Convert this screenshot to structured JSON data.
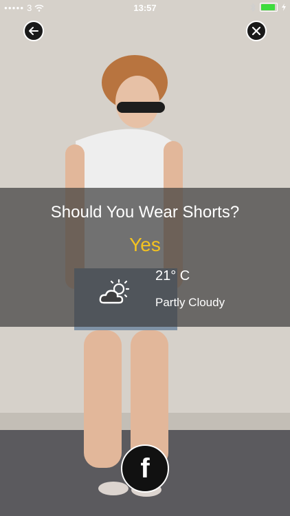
{
  "status": {
    "carrier": "3",
    "time": "13:57",
    "battery_color": "#3ddc3d"
  },
  "nav": {
    "back_icon": "arrow-left-icon",
    "close_icon": "close-icon"
  },
  "card": {
    "question": "Should You Wear Shorts?",
    "answer": "Yes",
    "answer_color": "#f3c220",
    "temperature": "21° C",
    "condition": "Partly Cloudy",
    "weather_icon": "partly-cloudy-icon"
  },
  "share": {
    "facebook_glyph": "f",
    "icon": "facebook-icon"
  }
}
